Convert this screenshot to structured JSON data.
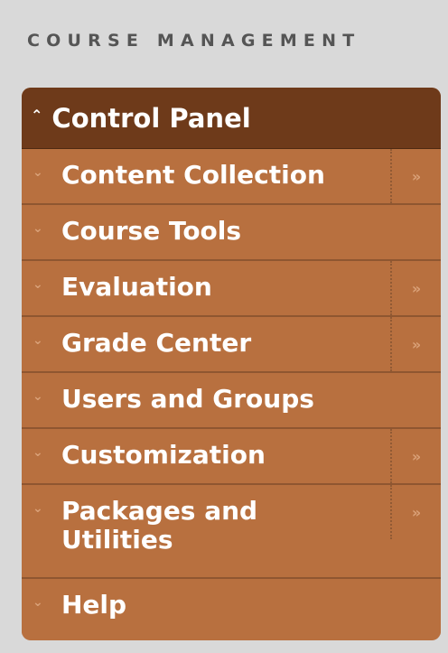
{
  "header": {
    "title": "COURSE MANAGEMENT"
  },
  "panel": {
    "title": "Control Panel",
    "items": [
      {
        "label": "Content Collection",
        "has_expand": true
      },
      {
        "label": "Course Tools",
        "has_expand": false
      },
      {
        "label": "Evaluation",
        "has_expand": true
      },
      {
        "label": "Grade Center",
        "has_expand": true
      },
      {
        "label": "Users and Groups",
        "has_expand": false
      },
      {
        "label": "Customization",
        "has_expand": true
      },
      {
        "label": "Packages and Utilities",
        "has_expand": true
      },
      {
        "label": "Help",
        "has_expand": false
      }
    ]
  },
  "icons": {
    "collapse": "double-chevron-up-icon",
    "expand": "double-chevron-down-icon",
    "flyout": "double-chevron-right-icon"
  },
  "colors": {
    "panel_header": "#6e3a1a",
    "panel_item": "#b8703f",
    "page_background": "#d9d9d9"
  }
}
